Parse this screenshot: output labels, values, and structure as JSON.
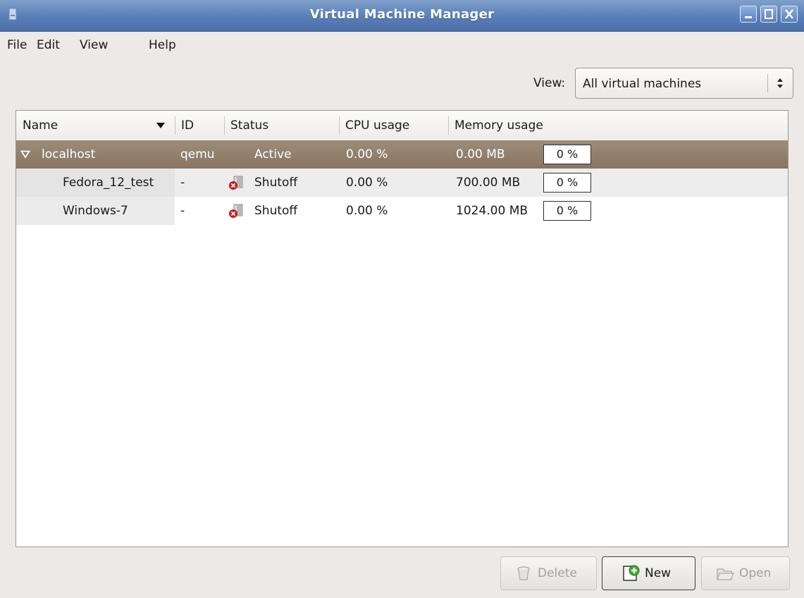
{
  "window": {
    "title": "Virtual Machine Manager"
  },
  "menu": {
    "file": "File",
    "edit": "Edit",
    "view": "View",
    "help": "Help"
  },
  "filter": {
    "label": "View:",
    "selected": "All virtual machines"
  },
  "columns": {
    "name": "Name",
    "id": "ID",
    "status": "Status",
    "cpu": "CPU usage",
    "memory": "Memory usage"
  },
  "host": {
    "name": "localhost",
    "id": "qemu",
    "status": "Active",
    "cpu": "0.00 %",
    "memory": "0.00 MB",
    "mem_pct": "0 %"
  },
  "vms": [
    {
      "name": "Fedora_12_test",
      "id": "-",
      "status": "Shutoff",
      "cpu": "0.00 %",
      "memory": "700.00 MB",
      "mem_pct": "0 %"
    },
    {
      "name": "Windows-7",
      "id": "-",
      "status": "Shutoff",
      "cpu": "0.00 %",
      "memory": "1024.00 MB",
      "mem_pct": "0 %"
    }
  ],
  "buttons": {
    "delete": "Delete",
    "new": "New",
    "open": "Open"
  },
  "icons": {
    "app": "vm-manager-icon",
    "shutoff": "shutoff-icon",
    "delete": "trash-icon",
    "new": "add-icon",
    "open": "folder-icon"
  }
}
